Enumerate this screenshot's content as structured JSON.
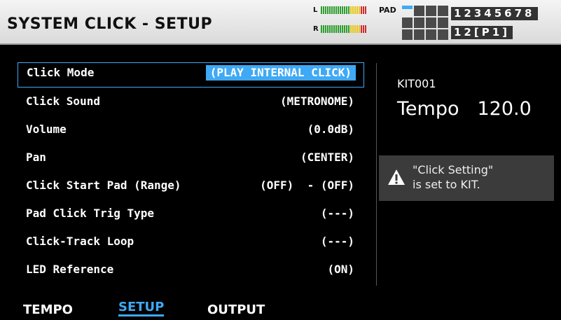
{
  "header": {
    "title": "SYSTEM CLICK - SETUP",
    "meter_l_label": "L",
    "meter_r_label": "R",
    "pad_label": "PAD",
    "channel_numbers": "12345678",
    "pad_page": "12[P1]"
  },
  "params": [
    {
      "label": "Click Mode",
      "value": "(PLAY INTERNAL CLICK)"
    },
    {
      "label": "Click Sound",
      "value": "(METRONOME)"
    },
    {
      "label": "Volume",
      "value": "(0.0dB)"
    },
    {
      "label": "Pan",
      "value": "(CENTER)"
    },
    {
      "label": "Click Start Pad (Range)",
      "value": "(OFF)  - (OFF)"
    },
    {
      "label": "Pad Click Trig Type",
      "value": "(---)"
    },
    {
      "label": "Click-Track Loop",
      "value": "(---)"
    },
    {
      "label": "LED Reference",
      "value": "(ON)"
    }
  ],
  "side": {
    "kit": "KIT001",
    "tempo_label": "Tempo",
    "tempo_value": "120.0",
    "note_line1": "\"Click Setting\"",
    "note_line2": "is set to KIT."
  },
  "tabs": [
    "TEMPO",
    "SETUP",
    "OUTPUT"
  ],
  "colors": {
    "accent": "#3fa9f5",
    "background": "#000000"
  },
  "icons": [
    "warning-icon"
  ]
}
